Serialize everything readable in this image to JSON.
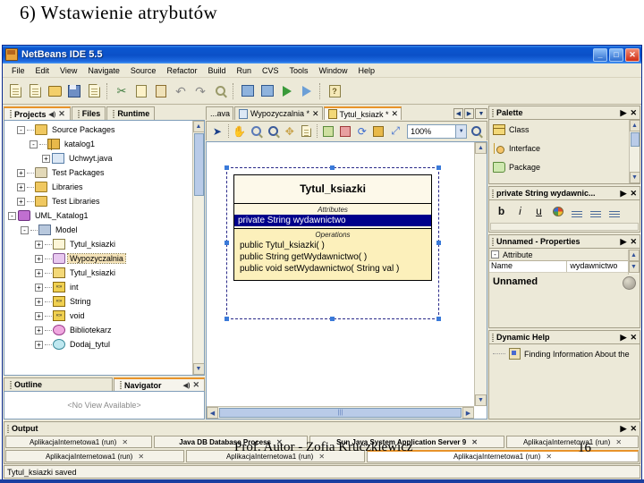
{
  "slide": {
    "title": "6) Wstawienie atrybutów",
    "author_overlay": "Prof. Autor - Zofia Kruczkiewicz",
    "page_number": "16"
  },
  "window": {
    "app_title": "NetBeans IDE 5.5",
    "logo_icon": "netbeans-logo-icon",
    "minimize_glyph": "_",
    "maximize_glyph": "□",
    "close_glyph": "✕"
  },
  "menubar": {
    "items": [
      {
        "label": "File"
      },
      {
        "label": "Edit"
      },
      {
        "label": "View"
      },
      {
        "label": "Navigate"
      },
      {
        "label": "Source"
      },
      {
        "label": "Refactor"
      },
      {
        "label": "Build"
      },
      {
        "label": "Run"
      },
      {
        "label": "CVS"
      },
      {
        "label": "Tools"
      },
      {
        "label": "Window"
      },
      {
        "label": "Help"
      }
    ]
  },
  "toolbar": {
    "buttons": [
      {
        "icon": "new-file-icon"
      },
      {
        "icon": "new-project-icon"
      },
      {
        "icon": "open-project-icon"
      },
      {
        "icon": "save-all-icon"
      },
      {
        "icon": "find-in-projects-icon"
      },
      {
        "icon": "cut-icon"
      },
      {
        "icon": "copy-icon"
      },
      {
        "icon": "paste-icon"
      },
      {
        "icon": "undo-icon"
      },
      {
        "icon": "redo-icon"
      },
      {
        "icon": "find-icon"
      },
      {
        "icon": "build-project-icon"
      },
      {
        "icon": "clean-build-icon"
      },
      {
        "icon": "run-project-icon"
      },
      {
        "icon": "debug-project-icon"
      },
      {
        "icon": "help-icon"
      }
    ]
  },
  "left": {
    "tabs": [
      {
        "label": "Projects",
        "active": true,
        "badge": "◀)",
        "closable": true
      },
      {
        "label": "Files",
        "active": false,
        "closable": false
      },
      {
        "label": "Runtime",
        "active": false,
        "closable": false
      }
    ],
    "tree": [
      {
        "label": "Source Packages",
        "indent": 1,
        "toggle": "-",
        "icon": "folder-icon"
      },
      {
        "label": "katalog1",
        "indent": 2,
        "toggle": "-",
        "icon": "package-icon"
      },
      {
        "label": "Uchwyt.java",
        "indent": 3,
        "toggle": "+",
        "icon": "java-file-icon"
      },
      {
        "label": "Test Packages",
        "indent": 1,
        "toggle": "+",
        "icon": "folder-icon"
      },
      {
        "label": "Libraries",
        "indent": 1,
        "toggle": "+",
        "icon": "folder-icon"
      },
      {
        "label": "Test Libraries",
        "indent": 1,
        "toggle": "+",
        "icon": "folder-icon"
      },
      {
        "label": "UML_Katalog1",
        "indent": 0,
        "toggle": "-",
        "icon": "uml-project-icon"
      },
      {
        "label": "Model",
        "indent": 1,
        "toggle": "-",
        "icon": "model-icon"
      },
      {
        "label": "Tytul_ksiazki",
        "indent": 2,
        "toggle": "+",
        "icon": "diagram-icon"
      },
      {
        "label": "Wypozyczalnia",
        "indent": 2,
        "toggle": "+",
        "icon": "usecase-icon",
        "selected": true
      },
      {
        "label": "Tytul_ksiazki",
        "indent": 2,
        "toggle": "+",
        "icon": "class-icon"
      },
      {
        "label": "int",
        "indent": 2,
        "toggle": "+",
        "icon": "datatype-icon"
      },
      {
        "label": "String",
        "indent": 2,
        "toggle": "+",
        "icon": "datatype-icon"
      },
      {
        "label": "void",
        "indent": 2,
        "toggle": "+",
        "icon": "datatype-icon"
      },
      {
        "label": "Bibliotekarz",
        "indent": 2,
        "toggle": "+",
        "icon": "actor-icon"
      },
      {
        "label": "Dodaj_tytul",
        "indent": 2,
        "toggle": "+",
        "icon": "oval-icon"
      }
    ],
    "outline_tabs": [
      {
        "label": "Outline",
        "active": false
      },
      {
        "label": "Navigator",
        "active": true,
        "badge": "◀)"
      }
    ],
    "outline_empty": "<No View Available>"
  },
  "editor": {
    "tabs": [
      {
        "label": "...ava",
        "active": false,
        "icon": "java-file-icon",
        "closable": false
      },
      {
        "label": "Wypozyczalnia *",
        "active": false,
        "icon": "uml-diagram-icon",
        "closable": true
      },
      {
        "label": "Tytul_ksiazk *",
        "active": true,
        "icon": "class-diagram-icon",
        "closable": true
      }
    ],
    "nav_buttons": [
      "◀",
      "▶",
      "▼"
    ],
    "diagram_toolbar": [
      {
        "icon": "select-tool-icon"
      },
      {
        "icon": "pan-tool-icon"
      },
      {
        "icon": "zoom-out-icon"
      },
      {
        "icon": "zoom-in-icon"
      },
      {
        "icon": "move-tool-icon"
      },
      {
        "icon": "fit-page-icon"
      },
      {
        "icon": "layout-icon"
      },
      {
        "icon": "export-image-icon"
      },
      {
        "icon": "refresh-icon"
      },
      {
        "icon": "add-element-icon"
      },
      {
        "icon": "fit-window-icon"
      }
    ],
    "zoom_value": "100%",
    "zoom_in_icon": "zoom-in-icon"
  },
  "uml": {
    "class_name": "Tytul_ksiazki",
    "attributes_label": "Attributes",
    "attributes": [
      {
        "text": "private String wydawnictwo",
        "selected": true
      }
    ],
    "operations_label": "Operations",
    "operations": [
      {
        "text": "public Tytul_ksiazki( )"
      },
      {
        "text": "public String  getWydawnictwo( )"
      },
      {
        "text": "public void  setWydawnictwo( String val )"
      }
    ]
  },
  "right": {
    "palette": {
      "title": "Palette",
      "items": [
        {
          "label": "Class",
          "icon": "class-icon"
        },
        {
          "label": "Interface",
          "icon": "interface-icon"
        },
        {
          "label": "Package",
          "icon": "package-icon"
        }
      ]
    },
    "format": {
      "title": "private String wydawnic...",
      "buttons": [
        {
          "icon": "bold-icon",
          "glyph": "b"
        },
        {
          "icon": "italic-icon",
          "glyph": "i"
        },
        {
          "icon": "underline-icon",
          "glyph": "u"
        },
        {
          "icon": "color-picker-icon",
          "glyph": ""
        },
        {
          "icon": "align-left-icon",
          "glyph": ""
        },
        {
          "icon": "align-center-icon",
          "glyph": ""
        },
        {
          "icon": "align-right-icon",
          "glyph": ""
        }
      ]
    },
    "properties": {
      "title": "Unnamed - Properties",
      "group": "Attribute",
      "rows": [
        {
          "key": "Name",
          "value": "wydawnictwo"
        }
      ],
      "description": "Unnamed"
    },
    "dynamic_help": {
      "title": "Dynamic Help",
      "items": [
        {
          "label": "Finding Information About the"
        }
      ]
    },
    "panel_icons": {
      "float": "▶",
      "close": "✕"
    }
  },
  "output": {
    "title": "Output",
    "tabs_row1": [
      {
        "label": "AplikacjaInternetowa1 (run)",
        "closable": true,
        "bold": false
      },
      {
        "label": "Java DB Database Process",
        "closable": true,
        "bold": true
      },
      {
        "label": "Sun Java System Application Server 9",
        "closable": true,
        "bold": true
      },
      {
        "label": "AplikacjaInternetowa1 (run)",
        "closable": true,
        "bold": false
      }
    ],
    "tabs_row2": [
      {
        "label": "AplikacjaInternetowa1 (run)",
        "closable": true,
        "bold": false
      },
      {
        "label": "AplikacjaInternetowa1 (run)",
        "closable": true,
        "bold": false
      },
      {
        "label": "AplikacjaInternetowa1 (run)",
        "closable": true,
        "bold": false,
        "active": true
      }
    ]
  },
  "status": {
    "message": "Tytul_ksiazki saved"
  }
}
